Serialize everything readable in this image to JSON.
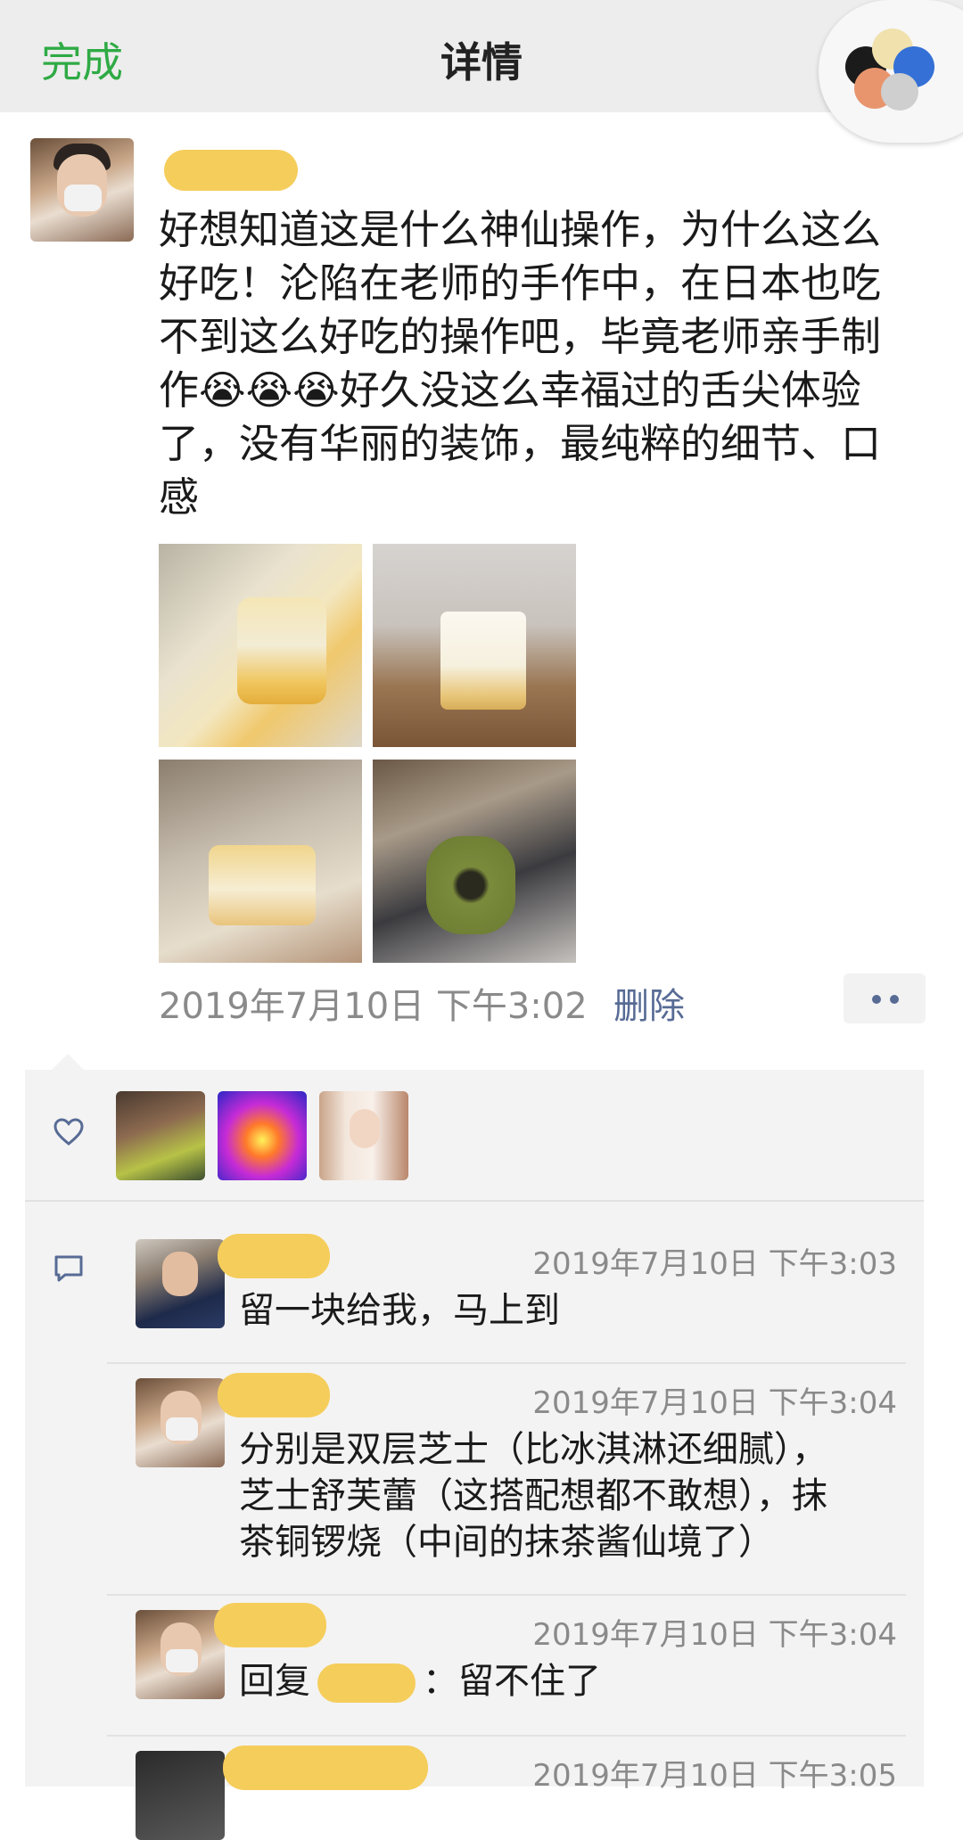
{
  "header": {
    "done_label": "完成",
    "title": "详情",
    "capsule_colors": [
      "#1b1b1b",
      "#f0e1ad",
      "#3470d6",
      "#e8956e",
      "#cfcfcf"
    ]
  },
  "post": {
    "text": "好想知道这是什么神仙操作，为什么这么好吃！沦陷在老师的手作中，在日本也吃不到这么好吃的操作吧，毕竟老师亲手制作😭😭😭好久没这么幸福过的舌尖体验了，没有华丽的装饰，最纯粹的细节、口感",
    "timestamp": "2019年7月10日 下午3:02",
    "delete_label": "删除",
    "photos": [
      {
        "name": "photo-cheesecake-slice"
      },
      {
        "name": "photo-cheesecake-in-hand"
      },
      {
        "name": "photo-souffle-cheesecake"
      },
      {
        "name": "photo-matcha-dorayaki"
      }
    ]
  },
  "likes": {
    "icon": "heart-icon",
    "avatars": [
      "like-avatar-1",
      "like-avatar-2",
      "like-avatar-3"
    ]
  },
  "comments": {
    "icon": "comment-icon",
    "items": [
      {
        "time": "2019年7月10日 下午3:03",
        "text": "留一块给我，马上到"
      },
      {
        "time": "2019年7月10日 下午3:04",
        "lines": [
          "分别是双层芝士（比冰淇淋还细腻），",
          "芝士舒芙蕾（这搭配想都不敢想），抹",
          "茶铜锣烧（中间的抹茶酱仙境了）"
        ]
      },
      {
        "time": "2019年7月10日 下午3:04",
        "reply_prefix": "回复",
        "reply_suffix": "：留不住了"
      },
      {
        "time": "2019年7月10日 下午3:05"
      }
    ]
  },
  "colors": {
    "accent_green": "#2faa45",
    "link_blue": "#576b95",
    "redaction_yellow": "#f5cd5b"
  }
}
